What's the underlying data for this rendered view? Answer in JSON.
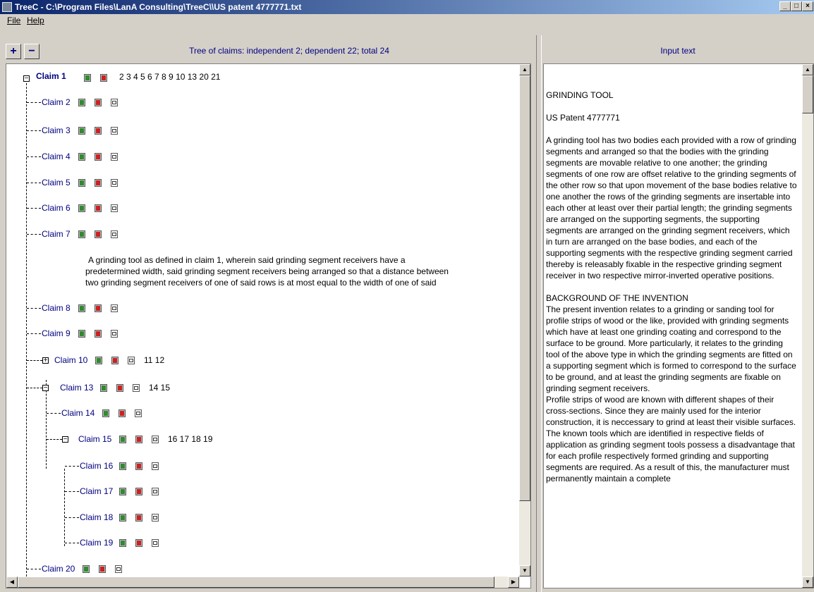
{
  "window": {
    "title": "TreeC - C:\\Program Files\\LanA Consulting\\TreeC\\\\US patent 4777771.txt",
    "minimize": "_",
    "maximize": "□",
    "close": "×"
  },
  "menu": {
    "file": "File",
    "help": "Help"
  },
  "tree": {
    "expand_all": "+",
    "collapse_all": "−",
    "header": "Tree of claims: independent 2; dependent 22; total 24",
    "claims": [
      {
        "label": "Claim 1",
        "deps": "2 3 4 5 6 7 8 9 10 13 20 21"
      },
      {
        "label": "Claim 2",
        "deps": ""
      },
      {
        "label": "Claim 3",
        "deps": ""
      },
      {
        "label": "Claim 4",
        "deps": ""
      },
      {
        "label": "Claim 5",
        "deps": ""
      },
      {
        "label": "Claim 6",
        "deps": ""
      },
      {
        "label": "Claim 7",
        "deps": ""
      },
      {
        "label": "Claim 8",
        "deps": ""
      },
      {
        "label": "Claim 9",
        "deps": ""
      },
      {
        "label": "Claim 10",
        "deps": "11 12"
      },
      {
        "label": "Claim 13",
        "deps": "14 15"
      },
      {
        "label": "Claim 14",
        "deps": ""
      },
      {
        "label": "Claim 15",
        "deps": "16 17 18 19"
      },
      {
        "label": "Claim 16",
        "deps": ""
      },
      {
        "label": "Claim 17",
        "deps": ""
      },
      {
        "label": "Claim 18",
        "deps": ""
      },
      {
        "label": "Claim 19",
        "deps": ""
      },
      {
        "label": "Claim 20",
        "deps": ""
      }
    ],
    "claim7_text": [
      "A grinding tool as defined in claim 1, wherein said grinding segment receivers have a",
      "predetermined width, said grinding segment receivers being arranged so that a distance between",
      "two grinding segment receivers of one of said rows is at most equal to the width of one of said"
    ]
  },
  "input": {
    "header": "Input text",
    "title": "GRINDING TOOL",
    "patent": "US Patent 4777771",
    "abstract": "A grinding tool has two bodies each provided with a row of grinding segments and arranged so that the bodies with the grinding segments are movable relative to one another; the grinding segments of one row are offset relative to the grinding segments of the other row so that upon movement of the base bodies relative to one another the rows of the grinding segments are insertable into each other at least over their partial length; the grinding segments are arranged on the supporting segments, the supporting segments are arranged on the grinding segment receivers, which in turn are arranged on the base bodies, and each of the supporting segments with the respective grinding segment carried thereby is releasably fixable in the respective grinding segment receiver in two respective mirror-inverted operative positions.",
    "background_heading": "BACKGROUND OF THE INVENTION",
    "background_p1": " The present invention relates to a grinding or sanding tool for profile strips of wood or the like, provided with grinding segments which have at least one grinding coating and correspond to the surface to be ground. More particularly, it relates to the grinding tool of the above type in which the grinding segments are fitted on a supporting segment which is formed to correspond to the surface to be ground, and at least the grinding segments are fixable on grinding segment receivers.",
    "background_p2": " Profile strips of wood are known with different shapes of their cross-sections. Since they are mainly used for the interior construction, it is neccessary to grind at least their visible surfaces. The known tools which are identified in respective fields of application as grinding segment tools possess a disadvantage that for each profile respectively formed grinding and supporting segments are required. As a result of this, the manufacturer must permanently maintain a complete"
  }
}
